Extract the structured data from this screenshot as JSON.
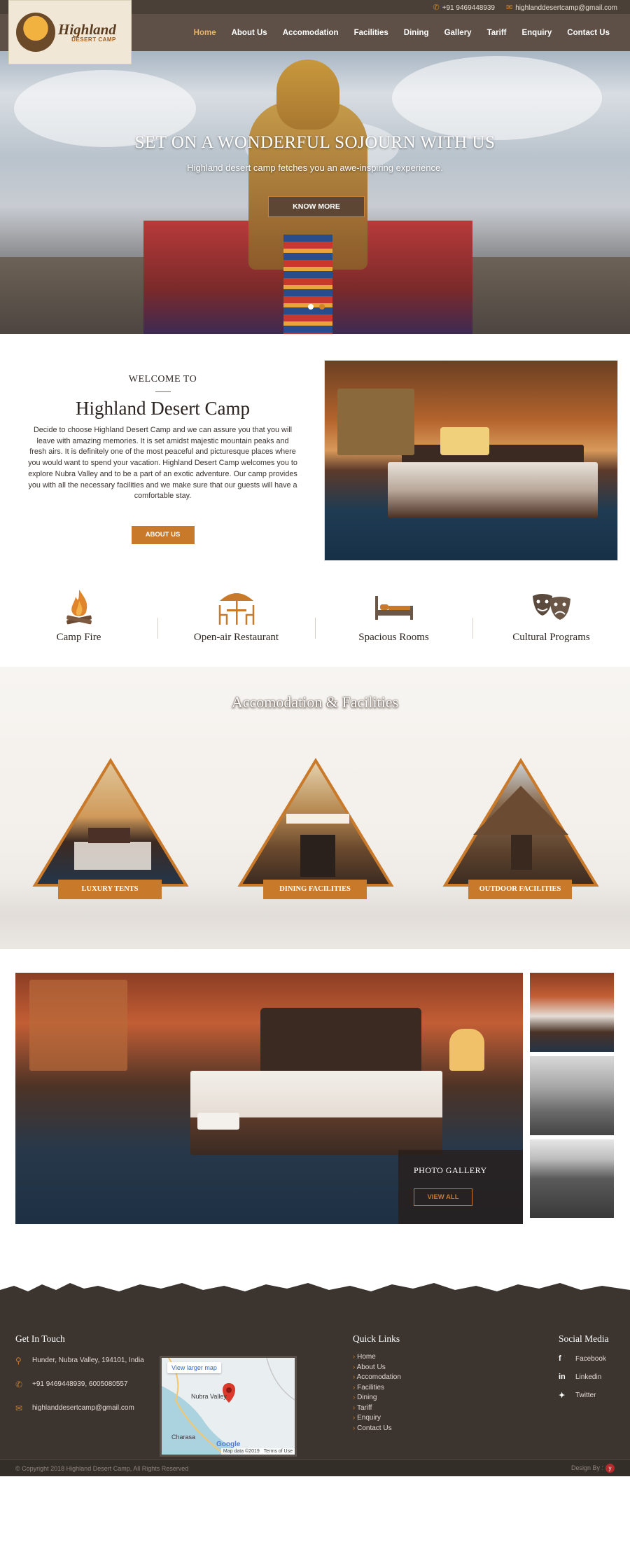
{
  "topbar": {
    "phone": "+91 9469448939",
    "email": "highlanddesertcamp@gmail.com"
  },
  "logo": {
    "name": "Highland",
    "sub": "DESERT CAMP"
  },
  "nav": [
    "Home",
    "About Us",
    "Accomodation",
    "Facilities",
    "Dining",
    "Gallery",
    "Tariff",
    "Enquiry",
    "Contact Us"
  ],
  "hero": {
    "title": "SET ON A WONDERFUL SOJOURN WITH US",
    "subtitle": "Highland desert camp fetches you an awe-inspiring experience.",
    "button": "KNOW MORE"
  },
  "welcome": {
    "kicker": "WELCOME TO",
    "title": "Highland Desert Camp",
    "body": "Decide to choose Highland Desert Camp and we can assure you that you will leave with amazing memories. It is set amidst majestic mountain peaks and fresh airs. It is definitely one of the most peaceful and picturesque places where you would want to spend your vacation. Highland Desert Camp welcomes you to explore Nubra Valley and to be a part of an exotic adventure. Our camp provides you with all the necessary facilities and we make sure that our guests will have a comfortable stay.",
    "button": "ABOUT US"
  },
  "features": [
    {
      "label": "Camp Fire",
      "icon": "campfire-icon"
    },
    {
      "label": "Open-air Restaurant",
      "icon": "restaurant-icon"
    },
    {
      "label": "Spacious Rooms",
      "icon": "bed-icon"
    },
    {
      "label": "Cultural Programs",
      "icon": "theatre-masks-icon"
    }
  ],
  "accommodation": {
    "title": "Accomodation & Facilities",
    "items": [
      "LUXURY TENTS",
      "DINING FACILITIES",
      "OUTDOOR FACILITIES"
    ]
  },
  "gallery": {
    "title": "PHOTO GALLERY",
    "button": "VIEW ALL"
  },
  "footer": {
    "get_in_touch": "Get In Touch",
    "address": "Hunder, Nubra Valley, 194101, India",
    "phones": "+91 9469448939, 6005080557",
    "email": "highlanddesertcamp@gmail.com",
    "map": {
      "link": "View larger map",
      "place": "Nubra Valley",
      "town": "Charasa",
      "brand": "Google",
      "credit": "Map data ©2019",
      "terms": "Terms of Use"
    },
    "quick_links_title": "Quick Links",
    "quick_links": [
      "Home",
      "About Us",
      "Accomodation",
      "Facilities",
      "Dining",
      "Tariff",
      "Enquiry",
      "Contact Us"
    ],
    "social_title": "Social Media",
    "social": [
      {
        "label": "Facebook",
        "icon": "facebook-icon"
      },
      {
        "label": "Linkedin",
        "icon": "linkedin-icon"
      },
      {
        "label": "Twitter",
        "icon": "twitter-icon"
      }
    ],
    "copyright": "© Copyright 2018 Highland Desert Camp, All Rights Reserved",
    "design_by": "Design By :"
  },
  "colors": {
    "accent": "#c9792a",
    "header": "#5e5046",
    "footer": "#3b342f"
  }
}
